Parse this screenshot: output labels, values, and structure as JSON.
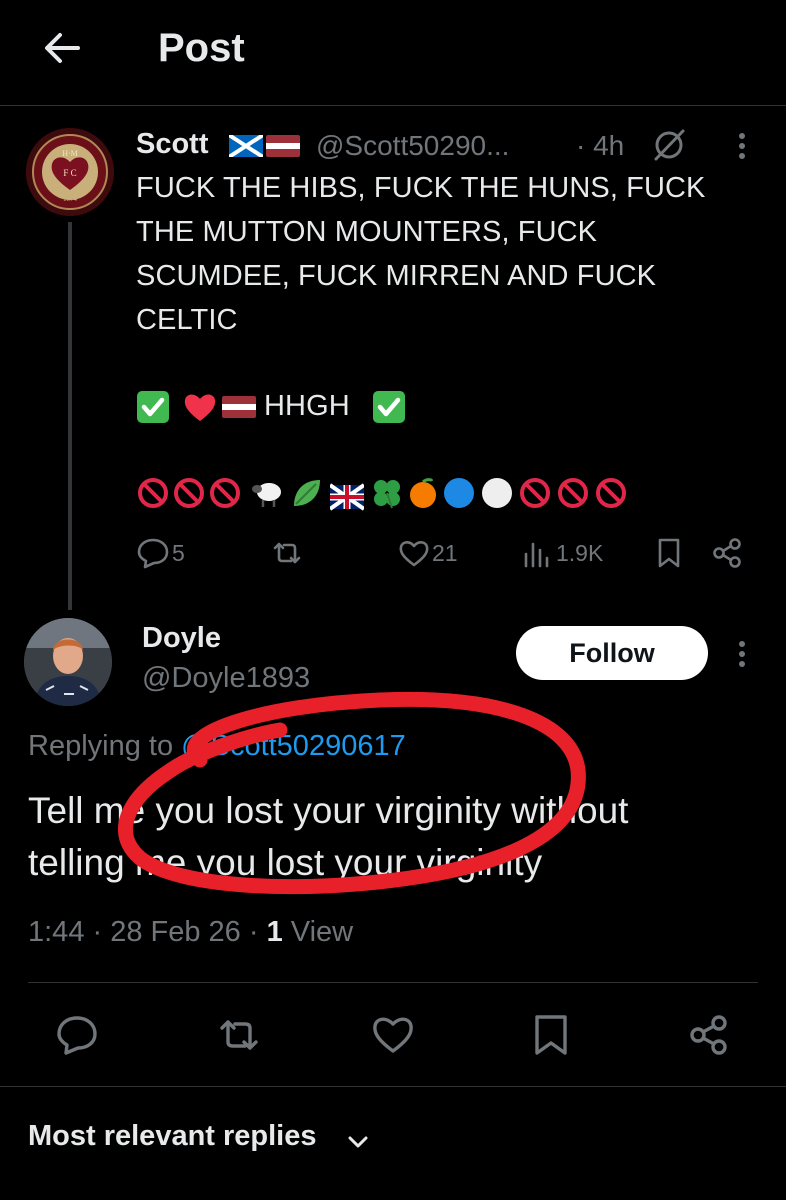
{
  "header": {
    "title": "Post"
  },
  "parent_post": {
    "author_name": "Scott",
    "handle": "@Scott50290...",
    "time": "· 4h",
    "text_lines": [
      "FUCK THE HIBS, FUCK THE HUNS, FUCK",
      "THE MUTTON MOUNTERS, FUCK",
      "SCUMDEE, FUCK MIRREN AND FUCK",
      "CELTIC"
    ],
    "hashtag_line_text": "HHGH",
    "avatar_text": {
      "top": "H·M",
      "mid": "F  C",
      "year": "1874"
    },
    "stats": {
      "replies": "5",
      "likes": "21",
      "views": "1.9K"
    }
  },
  "reply_post": {
    "author_name": "Doyle",
    "handle": "@Doyle1893",
    "follow_label": "Follow",
    "replying_prefix": "Replying to ",
    "replying_to": "@Scott50290617",
    "text_line1": "Tell me you lost your virginity without",
    "text_line2": "telling me you lost your virginity",
    "timestamp": "1:44 · 28 Feb 26 · ",
    "views_count": "1",
    "views_label": " View"
  },
  "replies_section": {
    "sort_label": "Most relevant replies"
  },
  "colors": {
    "background": "#000000",
    "primary_text": "#e7e9ea",
    "secondary_text": "#71767b",
    "link": "#1d9bf0",
    "divider": "#2f3336",
    "annotation": "#e8202a"
  }
}
